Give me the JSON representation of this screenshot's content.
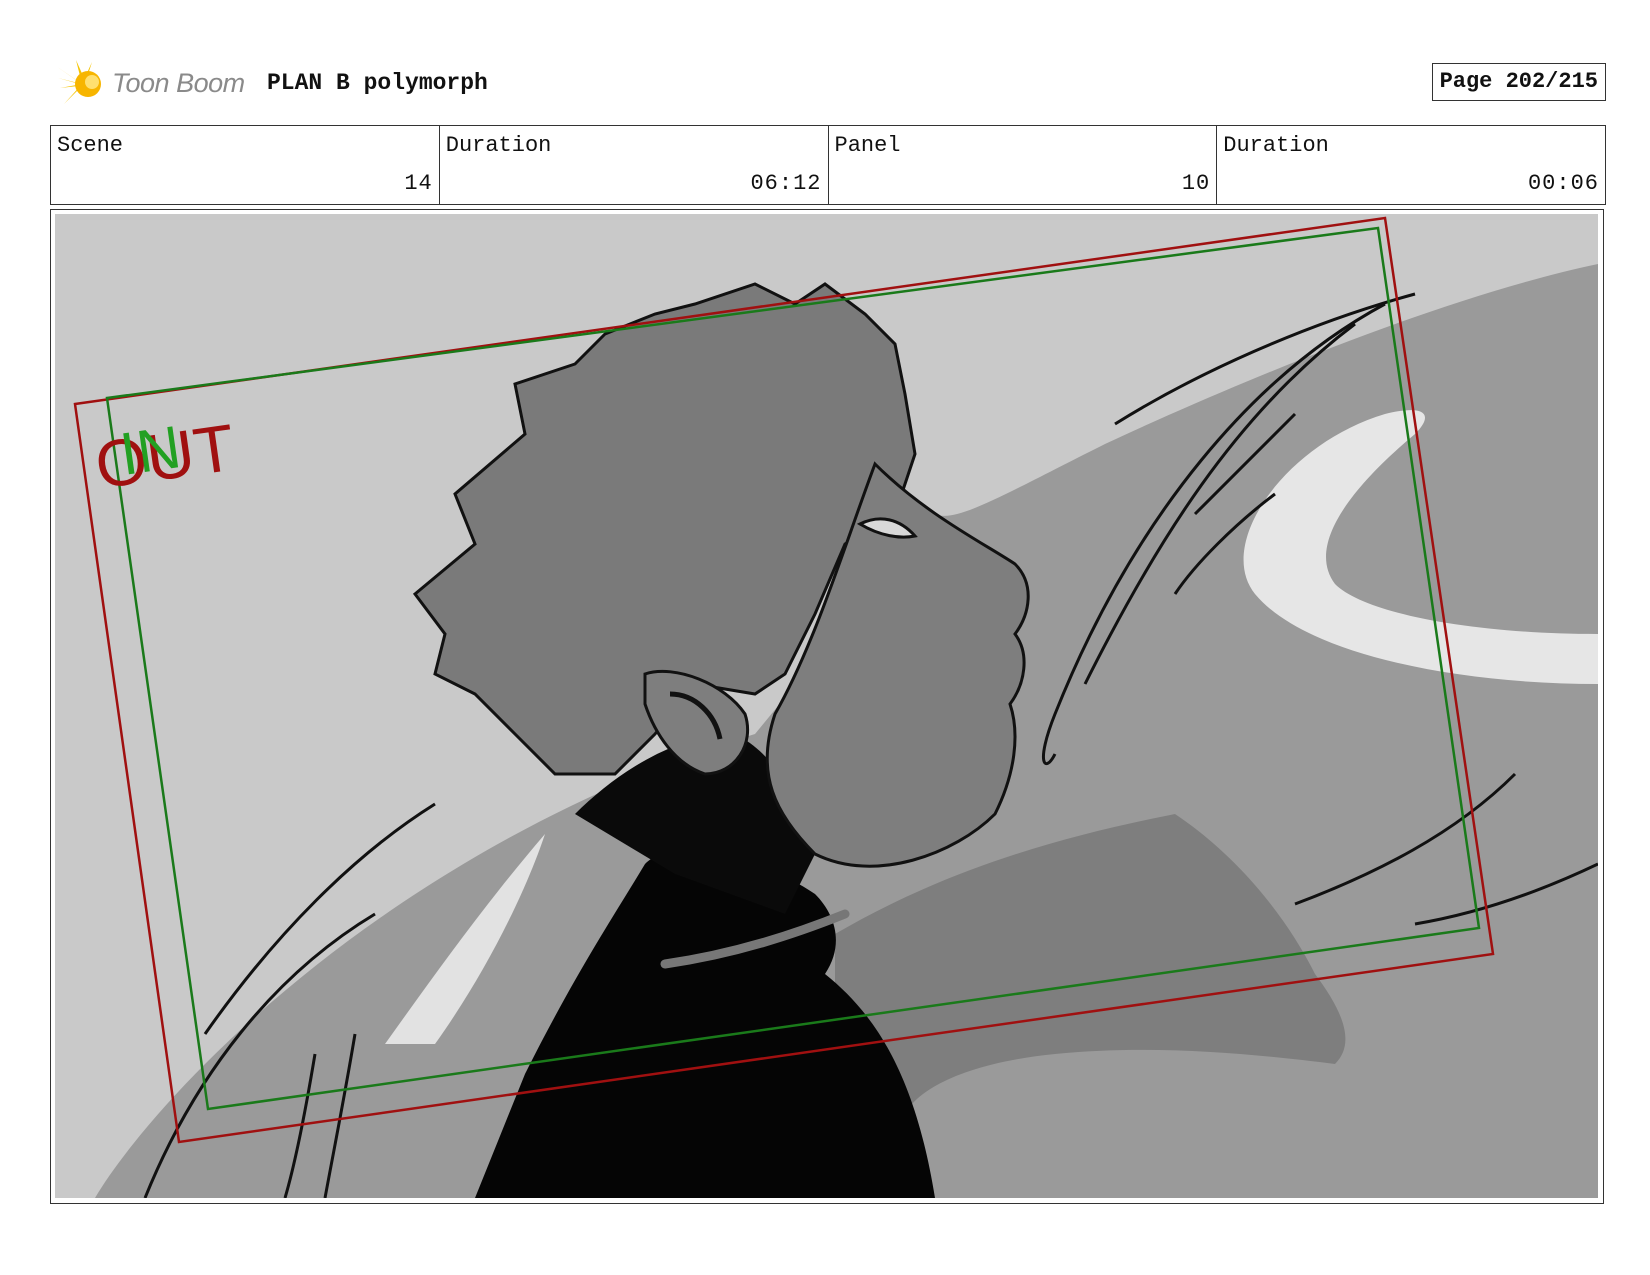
{
  "header": {
    "logo_text": "Toon Boom",
    "project_title": "PLAN B  polymorph",
    "page_label": "Page 202/215"
  },
  "info": {
    "scene_label": "Scene",
    "scene_value": "14",
    "scene_duration_label": "Duration",
    "scene_duration_value": "06:12",
    "panel_label": "Panel",
    "panel_value": "10",
    "panel_duration_label": "Duration",
    "panel_duration_value": "00:06"
  },
  "panel": {
    "camera_out_label": "OUT",
    "camera_in_label": "IN",
    "out_frame_color": "#a01010",
    "in_frame_color": "#1a7a1a"
  }
}
